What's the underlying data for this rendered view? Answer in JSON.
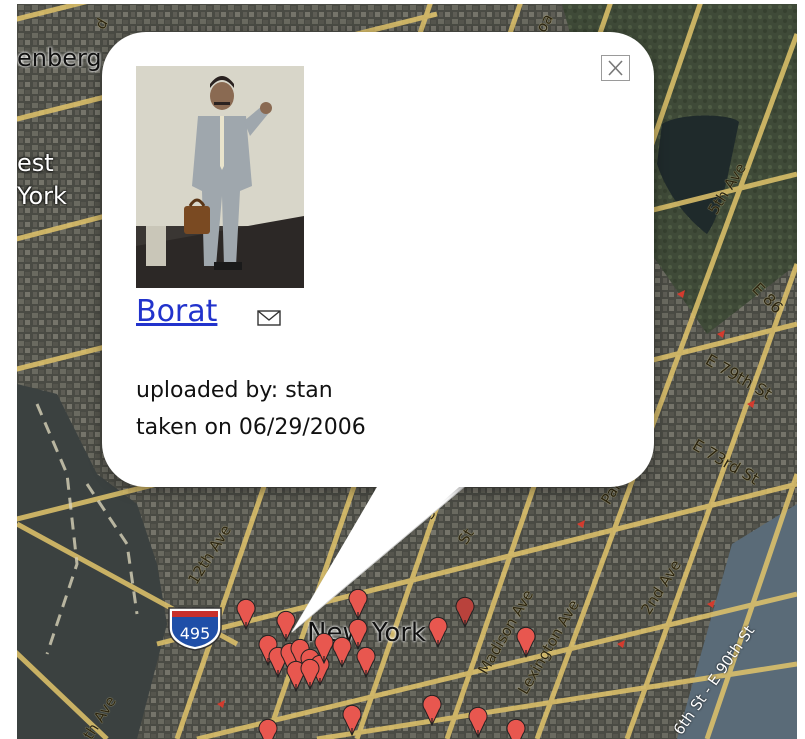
{
  "map": {
    "place_labels": [
      "enberg",
      "est",
      "York",
      "New York"
    ],
    "road_labels": [
      "5th Ave",
      "E 86",
      "E 79th St",
      "E 73rd St",
      "Park Ave",
      "2nd Ave",
      "Madison Ave",
      "Lexington Ave",
      "12th Ave",
      "St",
      "St",
      "th Ave",
      "6th St - E 90th St",
      "oa",
      "d"
    ],
    "interstate_shield": "495",
    "colors": {
      "road": "#e2c56b",
      "marker": "#e8574f",
      "marker_dark": "#b9423c",
      "water": "#2a3534",
      "link": "#2233cc"
    }
  },
  "popup": {
    "title": "Borat",
    "uploaded_by": "uploaded by: stan",
    "taken_on": "taken on 06/29/2006",
    "close_icon": "close-icon",
    "mail_icon": "envelope-icon"
  }
}
